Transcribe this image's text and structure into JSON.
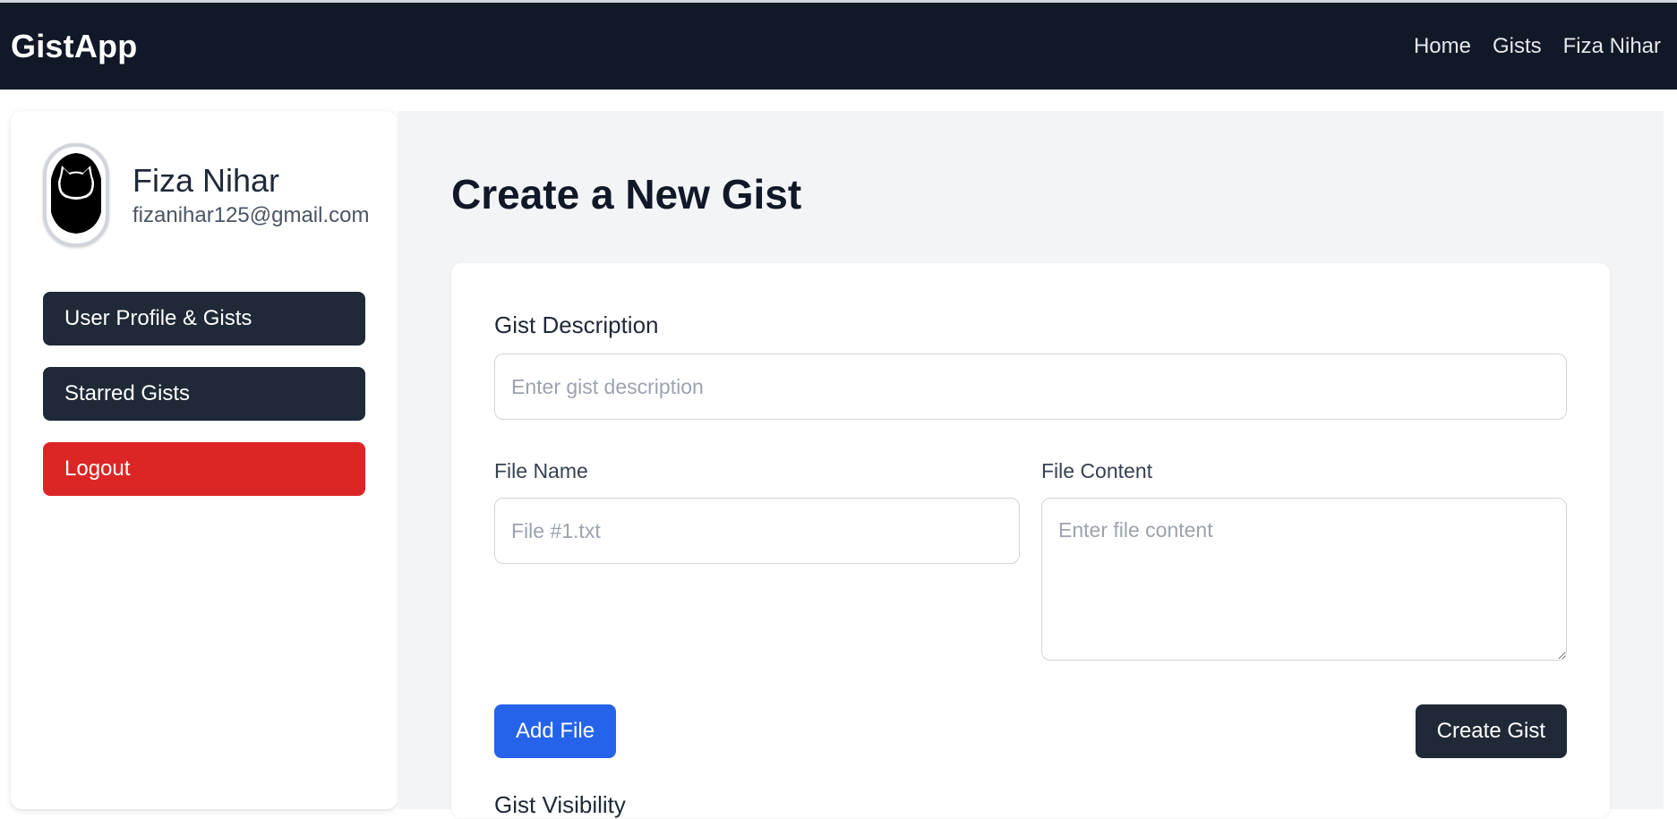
{
  "header": {
    "brand": "GistApp",
    "nav": [
      {
        "label": "Home"
      },
      {
        "label": "Gists"
      },
      {
        "label": "Fiza Nihar"
      }
    ]
  },
  "sidebar": {
    "user": {
      "name": "Fiza Nihar",
      "email": "fizanihar125@gmail.com",
      "avatar_icon": "github-octocat-icon"
    },
    "items": [
      {
        "label": "User Profile & Gists",
        "color": "#1f2937"
      },
      {
        "label": "Starred Gists",
        "color": "#1f2937"
      },
      {
        "label": "Logout",
        "color": "#dc2626"
      }
    ]
  },
  "main": {
    "title": "Create a New Gist",
    "form": {
      "description_label": "Gist Description",
      "description_placeholder": "Enter gist description",
      "description_value": "",
      "file_name_label": "File Name",
      "file_name_placeholder": "File #1.txt",
      "file_name_value": "",
      "file_content_label": "File Content",
      "file_content_placeholder": "Enter file content",
      "file_content_value": "",
      "add_file_label": "Add File",
      "create_gist_label": "Create Gist",
      "visibility_label": "Gist Visibility"
    }
  },
  "colors": {
    "nav_bg": "#111827",
    "button_dark": "#1f2937",
    "button_blue": "#2563eb",
    "button_red": "#dc2626",
    "main_bg": "#f3f4f6"
  }
}
